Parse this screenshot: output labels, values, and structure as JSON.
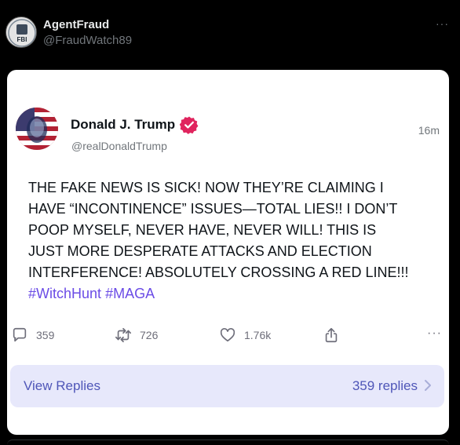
{
  "outer_post": {
    "display_name": "AgentFraud",
    "handle": "@FraudWatch89",
    "more_icon": "ellipsis-icon",
    "more_label": "···"
  },
  "embedded_post": {
    "display_name": "Donald J. Trump",
    "handle": "@realDonaldTrump",
    "time": "16m",
    "verified_icon": "verified-badge-icon",
    "text_lines": [
      "THE FAKE NEWS IS SICK! NOW THEY’RE CLAIMING I",
      "HAVE “INCONTINENCE” ISSUES—TOTAL LIES!! I DON’T",
      "POOP MYSELF, NEVER HAVE, NEVER WILL! THIS IS",
      "JUST MORE DESPERATE ATTACKS AND ELECTION",
      "INTERFERENCE! ABSOLUTELY CROSSING A RED LINE!!!"
    ],
    "hashtags": [
      "#WitchHunt",
      "#MAGA"
    ],
    "actions": {
      "replies": "359",
      "reposts": "726",
      "likes": "1.76k",
      "more_label": "···"
    },
    "replies_bar": {
      "label": "View Replies",
      "count_text": "359 replies"
    }
  },
  "colors": {
    "background": "#000000",
    "card": "#ffffff",
    "hashtag": "#6b4ce6",
    "verified": "#e0245e",
    "replies_bar_bg": "#e7e8fb",
    "replies_bar_text": "#4f56b8"
  }
}
